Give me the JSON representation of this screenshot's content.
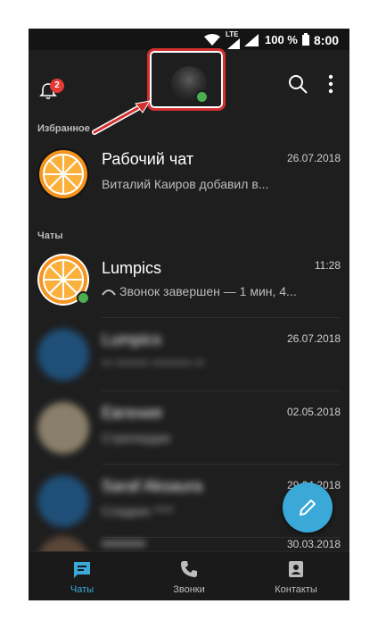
{
  "status": {
    "network": "LTE",
    "battery": "100 %",
    "time": "8:00"
  },
  "topbar": {
    "notification_count": "2",
    "icons": [
      "bell-icon",
      "search-icon",
      "more-vert-icon"
    ]
  },
  "sections": {
    "favorites": "Избранное",
    "chats": "Чаты"
  },
  "favorites": [
    {
      "title": "Рабочий чат",
      "date": "26.07.2018",
      "preview": "Виталий  Каиров добавил в..."
    }
  ],
  "chats": [
    {
      "title": "Lumpics",
      "date": "11:28",
      "preview": "Звонок завершен — 1 мин, 4...",
      "online": true
    },
    {
      "title": "Lumpics",
      "date": "26.07.2018",
      "preview": "** ******* ******** **",
      "blurred": true
    },
    {
      "title": "Евгения",
      "date": "02.05.2018",
      "preview": "Стрелердик",
      "blurred": true
    },
    {
      "title": "Saraf Aksaura",
      "date": "29.04.2018",
      "preview": "Сладких ****",
      "blurred": true
    },
    {
      "title": "*******",
      "date": "30.03.2018",
      "preview": "",
      "blurred": true
    }
  ],
  "nav": [
    {
      "label": "Чаты",
      "icon": "chat-icon",
      "active": true
    },
    {
      "label": "Звонки",
      "icon": "phone-icon"
    },
    {
      "label": "Контакты",
      "icon": "contacts-icon"
    }
  ],
  "colors": {
    "accent": "#3aa9d8",
    "badge": "#e53935",
    "online": "#4caf50",
    "highlight": "#d32f2f",
    "orange": "#f5941e"
  }
}
